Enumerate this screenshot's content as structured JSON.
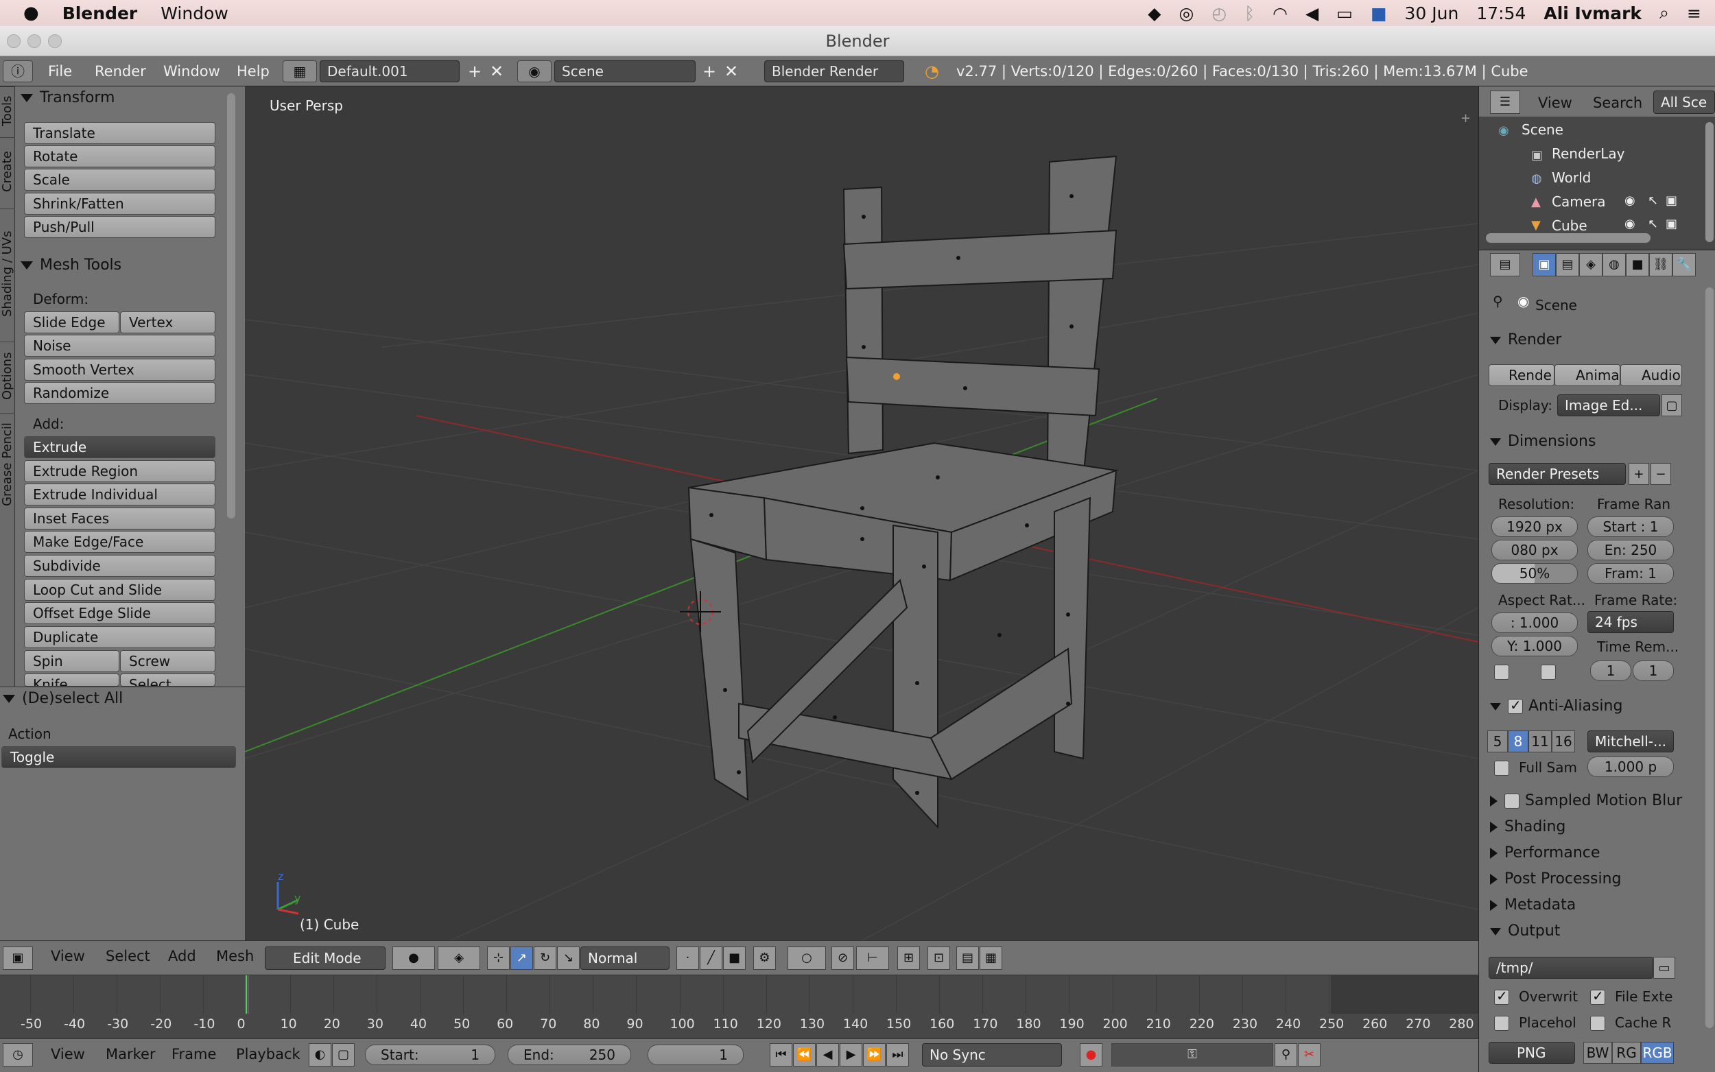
{
  "menubar": {
    "app": "Blender",
    "items": [
      "Window"
    ],
    "date": "30 Jun",
    "time": "17:54",
    "user": "Ali Ivmark"
  },
  "window": {
    "title": "Blender"
  },
  "info_header": {
    "menus": [
      "File",
      "Render",
      "Window",
      "Help"
    ],
    "screen": "Default.001",
    "scene": "Scene",
    "engine": "Blender Render",
    "stats": "v2.77 | Verts:0/120 | Edges:0/260 | Faces:0/130 | Tris:260 | Mem:13.67M | Cube"
  },
  "left_tabs": [
    "Tools",
    "Create",
    "Shading / UVs",
    "Options",
    "Grease Pencil"
  ],
  "toolshelf": {
    "transform": {
      "title": "Transform",
      "buttons": [
        "Translate",
        "Rotate",
        "Scale",
        "Shrink/Fatten",
        "Push/Pull"
      ]
    },
    "mesh_tools": {
      "title": "Mesh Tools",
      "deform_label": "Deform:",
      "slide_edge": "Slide Edge",
      "vertex": "Vertex",
      "deform_buttons": [
        "Noise",
        "Smooth Vertex",
        "Randomize"
      ],
      "add_label": "Add:",
      "extrude": "Extrude",
      "add_buttons": [
        "Extrude Region",
        "Extrude Individual",
        "Inset Faces",
        "Make Edge/Face",
        "Subdivide",
        "Loop Cut and Slide",
        "Offset Edge Slide",
        "Duplicate"
      ],
      "spin": "Spin",
      "screw": "Screw",
      "knife": "Knife",
      "select": "Select"
    }
  },
  "operator": {
    "title": "(De)select All",
    "action_label": "Action",
    "action_value": "Toggle"
  },
  "viewport": {
    "view_label": "User Persp",
    "object_label": "(1) Cube",
    "axis_z": "z",
    "axis_y": "y"
  },
  "view3d_header": {
    "menus": [
      "View",
      "Select",
      "Add",
      "Mesh"
    ],
    "mode": "Edit Mode",
    "orientation": "Normal"
  },
  "timeline": {
    "ticks": [
      "-50",
      "-40",
      "-30",
      "-20",
      "-10",
      "0",
      "10",
      "20",
      "30",
      "40",
      "50",
      "60",
      "70",
      "80",
      "90",
      "100",
      "110",
      "120",
      "130",
      "140",
      "150",
      "160",
      "170",
      "180",
      "190",
      "200",
      "210",
      "220",
      "230",
      "240",
      "250",
      "260",
      "270",
      "280"
    ],
    "menus": [
      "View",
      "Marker",
      "Frame",
      "Playback"
    ],
    "start_label": "Start:",
    "start_value": "1",
    "end_label": "End:",
    "end_value": "250",
    "current": "1",
    "sync": "No Sync"
  },
  "outliner": {
    "menus": [
      "View",
      "Search"
    ],
    "filter": "All Sce",
    "rows": [
      "Scene",
      "RenderLay",
      "World",
      "Camera",
      "Cube"
    ]
  },
  "properties": {
    "context": "Scene",
    "render": {
      "title": "Render",
      "buttons": [
        "Rende",
        "Anima",
        "Audio"
      ],
      "display_label": "Display:",
      "display_value": "Image Ed..."
    },
    "dimensions": {
      "title": "Dimensions",
      "presets": "Render Presets",
      "resolution_label": "Resolution:",
      "res_x": "1920 px",
      "res_y": "080 px",
      "res_pct": "50%",
      "frame_range_label": "Frame Ran",
      "start": "Start : 1",
      "end": "En: 250",
      "frame": "Fram: 1",
      "aspect_label": "Aspect Rat...",
      "aspect_x": ": 1.000",
      "aspect_y": "Y: 1.000",
      "frame_rate_label": "Frame Rate:",
      "fps": "24 fps",
      "time_remap_label": "Time Rem...",
      "remap_old": "1",
      "remap_new": "1"
    },
    "antialiasing": {
      "title": "Anti-Aliasing",
      "samples": [
        "5",
        "8",
        "11",
        "16"
      ],
      "filter": "Mitchell-...",
      "full_sample": "Full Sam",
      "size": "1.000 p"
    },
    "collapsed": [
      "Sampled Motion Blur",
      "Shading",
      "Performance",
      "Post Processing",
      "Metadata"
    ],
    "output": {
      "title": "Output",
      "path": "/tmp/",
      "overwrite": "Overwrit",
      "file_ext": "File Exte",
      "placeholders": "Placehol",
      "cache": "Cache R",
      "format": "PNG",
      "color_modes": [
        "BW",
        "RG",
        "RGB"
      ]
    }
  },
  "colors": {
    "selected_blue": "#5680c2",
    "panel_grey": "#727272",
    "viewport_bg": "#3a3a3a"
  }
}
